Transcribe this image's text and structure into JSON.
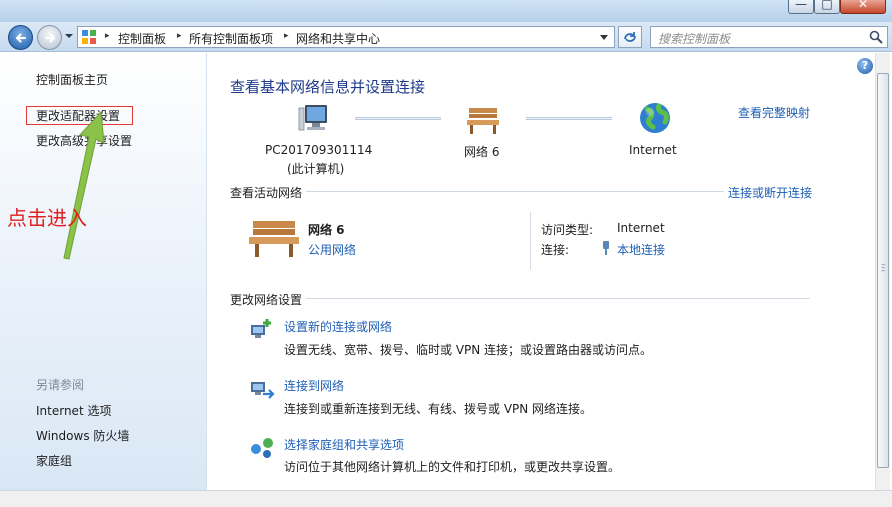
{
  "window": {
    "min_glyph": "—",
    "max_glyph": "□",
    "close_glyph": "✕"
  },
  "address_bar": {
    "breadcrumbs": [
      "控制面板",
      "所有控制面板项",
      "网络和共享中心"
    ],
    "separator": "▸"
  },
  "search": {
    "placeholder": "搜索控制面板"
  },
  "sidebar": {
    "home": "控制面板主页",
    "change_adapter": "更改适配器设置",
    "change_advanced_sharing": "更改高级共享设置",
    "see_also_title": "另请参阅",
    "see_also": [
      "Internet 选项",
      "Windows 防火墙",
      "家庭组"
    ]
  },
  "annotation": {
    "text": "点击进入",
    "color": "#e02020"
  },
  "main": {
    "title": "查看基本网络信息并设置连接",
    "see_full_map": "查看完整映射",
    "network_map": {
      "computer_name": "PC201709301114",
      "computer_sub": "(此计算机)",
      "network": "网络  6",
      "internet": "Internet"
    },
    "active_networks": {
      "header": "查看活动网络",
      "connect_link": "连接或断开连接",
      "network_name": "网络  6",
      "network_type": "公用网络",
      "access_type_label": "访问类型:",
      "access_type_value": "Internet",
      "connections_label": "连接:",
      "connections_value": "本地连接"
    },
    "change_settings": {
      "header": "更改网络设置",
      "tasks": [
        {
          "title": "设置新的连接或网络",
          "desc": "设置无线、宽带、拨号、临时或 VPN 连接；或设置路由器或访问点。"
        },
        {
          "title": "连接到网络",
          "desc": "连接到或重新连接到无线、有线、拨号或 VPN 网络连接。"
        },
        {
          "title": "选择家庭组和共享选项",
          "desc": "访问位于其他网络计算机上的文件和打印机，或更改共享设置。"
        }
      ]
    }
  },
  "help_glyph": "?",
  "colors": {
    "link": "#1e5fb4",
    "title": "#1e3a8a",
    "highlight": "#e53935",
    "arrow": "#8bc34a"
  }
}
